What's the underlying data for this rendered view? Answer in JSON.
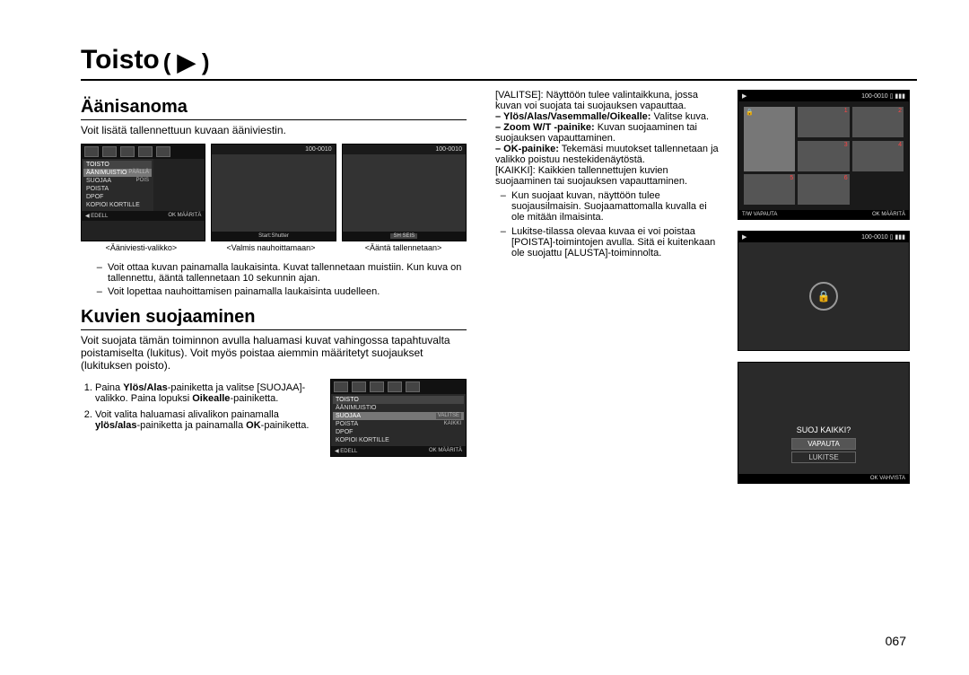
{
  "page": {
    "title": "Toisto",
    "play_symbol": "( ▶ )",
    "page_number": "067"
  },
  "section1": {
    "heading": "Äänisanoma",
    "intro": "Voit lisätä tallennettuun kuvaan ääniviestin.",
    "screen_a": {
      "counter": "100-0010",
      "menu_header": "TOISTO",
      "menu_items": [
        {
          "label": "ÄÄNIMUISTIO",
          "sub": "PÄÄLLÄ"
        },
        {
          "label": "SUOJAA",
          "sub": "POIS"
        },
        {
          "label": "POISTA",
          "sub": ""
        },
        {
          "label": "DPOF",
          "sub": ""
        },
        {
          "label": "KOPIOI KORTILLE",
          "sub": ""
        }
      ],
      "back": "◀ EDELL",
      "ok": "OK MÄÄRITÄ",
      "caption": "<Ääniviesti-valikko>"
    },
    "screen_b": {
      "counter": "100-0010",
      "btn": "Start:Shutter",
      "caption": "<Valmis nauhoittamaan>"
    },
    "screen_c": {
      "counter": "100-0010",
      "btn": "SH SEIS",
      "caption": "<Ääntä tallennetaan>"
    },
    "notes": [
      "Voit ottaa kuvan painamalla laukaisinta. Kuvat tallennetaan muistiin. Kun kuva on tallennettu, ääntä tallennetaan 10 sekunnin ajan.",
      "Voit lopettaa nauhoittamisen painamalla laukaisinta uudelleen."
    ]
  },
  "section2": {
    "heading": "Kuvien suojaaminen",
    "intro": "Voit suojata tämän toiminnon avulla haluamasi kuvat vahingossa tapahtuvalta poistamiselta (lukitus). Voit myös poistaa aiemmin määritetyt suojaukset (lukituksen poisto).",
    "steps": [
      "Paina Ylös/Alas-painiketta ja valitse [SUOJAA]-valikko. Paina lopuksi Oikealle-painiketta.",
      "Voit valita haluamasi alivalikon painamalla ylös/alas-painiketta ja painamalla OK-painiketta."
    ],
    "screen": {
      "menu_header": "TOISTO",
      "menu_items": [
        {
          "label": "ÄÄNIMUISTIO",
          "sub": ""
        },
        {
          "label": "SUOJAA",
          "sub": "VALITSE"
        },
        {
          "label": "POISTA",
          "sub": "KAIKKI"
        },
        {
          "label": "DPOF",
          "sub": ""
        },
        {
          "label": "KOPIOI KORTILLE",
          "sub": ""
        }
      ],
      "back": "◀ EDELL",
      "ok": "OK MÄÄRITÄ"
    }
  },
  "column_right": {
    "defs": [
      {
        "term": "[VALITSE]:",
        "desc": "Näyttöön tulee valintaikkuna, jossa kuvan voi suojata tai suojauksen vapauttaa."
      },
      {
        "term": "– Ylös/Alas/Vasemmalle/Oikealle:",
        "desc": "Valitse kuva."
      },
      {
        "term": "– Zoom W/T -painike:",
        "desc": "Kuvan suojaaminen tai suojauksen vapauttaminen."
      },
      {
        "term": "– OK-painike:",
        "desc": "Tekemäsi muutokset tallennetaan ja valikko poistuu nestekidenäytöstä."
      },
      {
        "term": "[KAIKKI]:",
        "desc": "Kaikkien tallennettujen kuvien suojaaminen tai suojauksen vapauttaminen."
      }
    ],
    "bullets": [
      "Kun suojaat kuvan, näyttöön tulee suojausilmaisin. Suojaamattomalla kuvalla ei ole mitään ilmaisinta.",
      "Lukitse-tilassa olevaa kuvaa ei voi poistaa [POISTA]-toimintojen avulla. Sitä ei kuitenkaan ole suojattu [ALUSTA]-toiminnolta."
    ],
    "thumb1": {
      "top": "▶   100-0010",
      "bottom_left": "T/W VAPAUTA",
      "bottom_right": "OK MÄÄRITÄ"
    },
    "thumb2": {
      "top": "▶   100-0010"
    },
    "thumb3": {
      "title": "SUOJ KAIKKI?",
      "opt1": "VAPAUTA",
      "opt2": "LUKITSE",
      "ok": "OK  VAHVISTA"
    }
  }
}
